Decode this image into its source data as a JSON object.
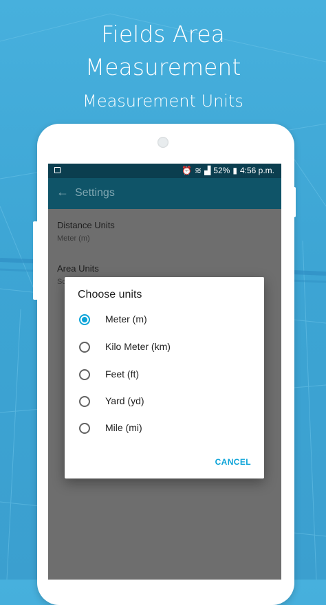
{
  "promo": {
    "title_line1": "Fields Area",
    "title_line2": "Measurement",
    "subtitle": "Measurement Units"
  },
  "status_bar": {
    "battery": "52%",
    "time": "4:56 p.m."
  },
  "app_bar": {
    "title": "Settings"
  },
  "settings": {
    "distance_units": {
      "title": "Distance Units",
      "value": "Meter (m)"
    },
    "area_units": {
      "title": "Area Units",
      "value": "Sc"
    }
  },
  "dialog": {
    "title": "Choose units",
    "options": [
      {
        "label": "Meter (m)",
        "selected": true
      },
      {
        "label": "Kilo Meter (km)",
        "selected": false
      },
      {
        "label": "Feet (ft)",
        "selected": false
      },
      {
        "label": "Yard (yd)",
        "selected": false
      },
      {
        "label": "Mile (mi)",
        "selected": false
      }
    ],
    "cancel_label": "CANCEL"
  },
  "colors": {
    "accent": "#0aa3d8",
    "app_bar": "#0f5468",
    "status_bar": "#0b3e4f",
    "background": "#45acd9"
  }
}
